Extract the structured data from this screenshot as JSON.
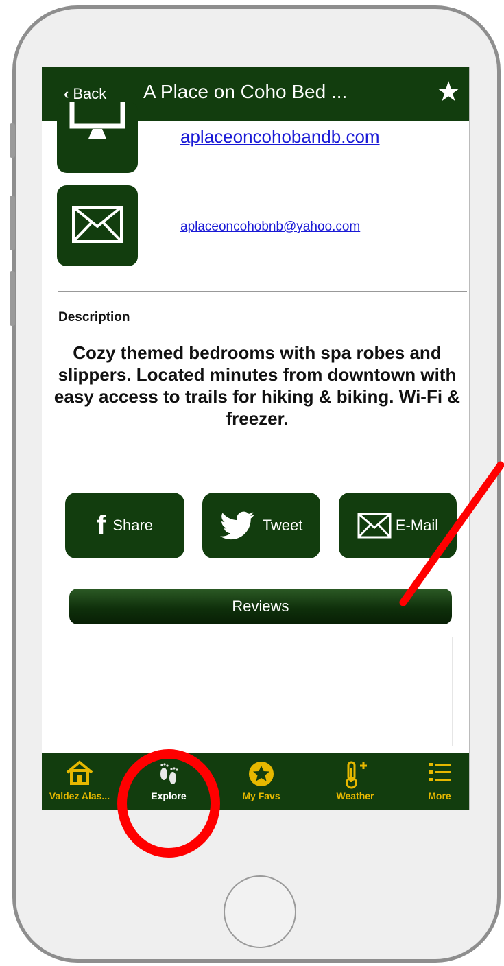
{
  "header": {
    "back_label": "Back",
    "title": "A Place on Coho Bed ...",
    "favorite_icon": "star-icon"
  },
  "contact": {
    "website": "aplaceoncohobandb.com",
    "website_icon": "monitor-icon",
    "email": "aplaceoncohobnb@yahoo.com",
    "email_icon": "envelope-icon"
  },
  "description": {
    "label": "Description",
    "text": "Cozy themed bedrooms with spa robes and slippers. Located minutes from downtown with easy access to trails for hiking & biking. Wi-Fi & freezer."
  },
  "share": {
    "facebook_label": "Share",
    "twitter_label": "Tweet",
    "email_label": "E-Mail"
  },
  "reviews_label": "Reviews",
  "tabs": [
    {
      "label": "Valdez Alas...",
      "icon": "home-icon"
    },
    {
      "label": "Explore",
      "icon": "footprints-icon",
      "active": true
    },
    {
      "label": "My Favs",
      "icon": "star-circle-icon"
    },
    {
      "label": "Weather",
      "icon": "thermometer-icon"
    },
    {
      "label": "More",
      "icon": "list-icon"
    }
  ],
  "colors": {
    "brand_green": "#123d0e",
    "tab_accent": "#e6b800",
    "link": "#1a1ad6",
    "annotation_red": "#ff0000"
  }
}
